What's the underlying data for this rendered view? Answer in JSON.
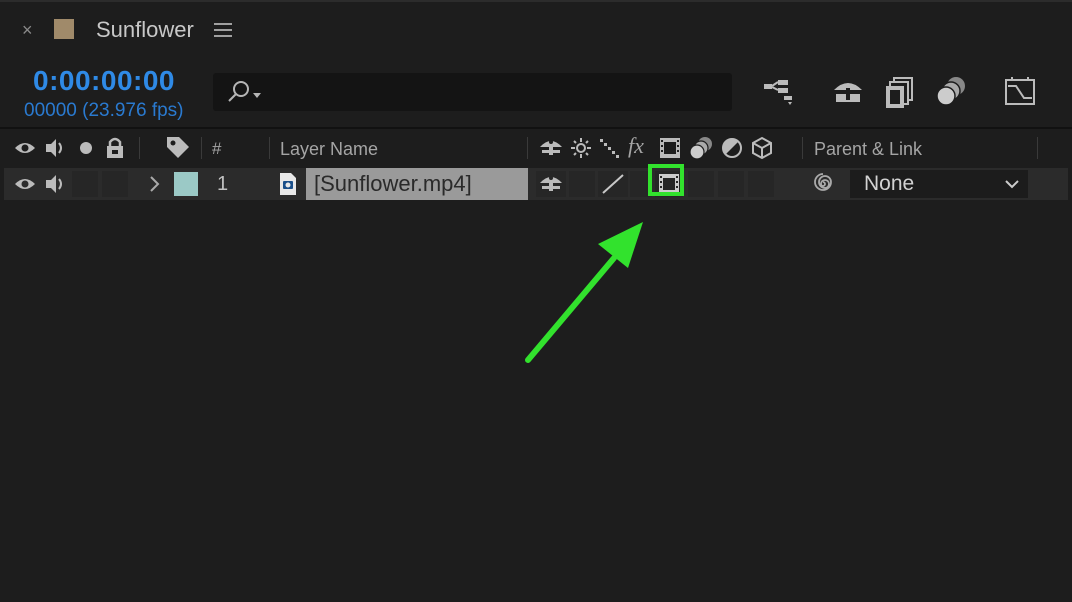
{
  "tab": {
    "close_label": "×",
    "comp_name": "Sunflower",
    "comp_color": "#a08a6a"
  },
  "time": {
    "timecode": "0:00:00:00",
    "frame_fps": "00000 (23.976 fps)"
  },
  "search": {
    "placeholder": ""
  },
  "toolbar": {
    "icons": [
      "composition-flowchart-icon",
      "draft-3d-icon",
      "frame-blending-icon",
      "motion-blur-icon",
      "graph-editor-icon"
    ]
  },
  "columns": {
    "number": "#",
    "layer_name": "Layer Name",
    "fx": "fx",
    "parent_link": "Parent & Link"
  },
  "layer": {
    "index": "1",
    "name": "[Sunflower.mp4]",
    "label_color": "#9bc9c6",
    "parent": "None"
  },
  "annotation": {
    "highlight_color": "#32e22d"
  }
}
